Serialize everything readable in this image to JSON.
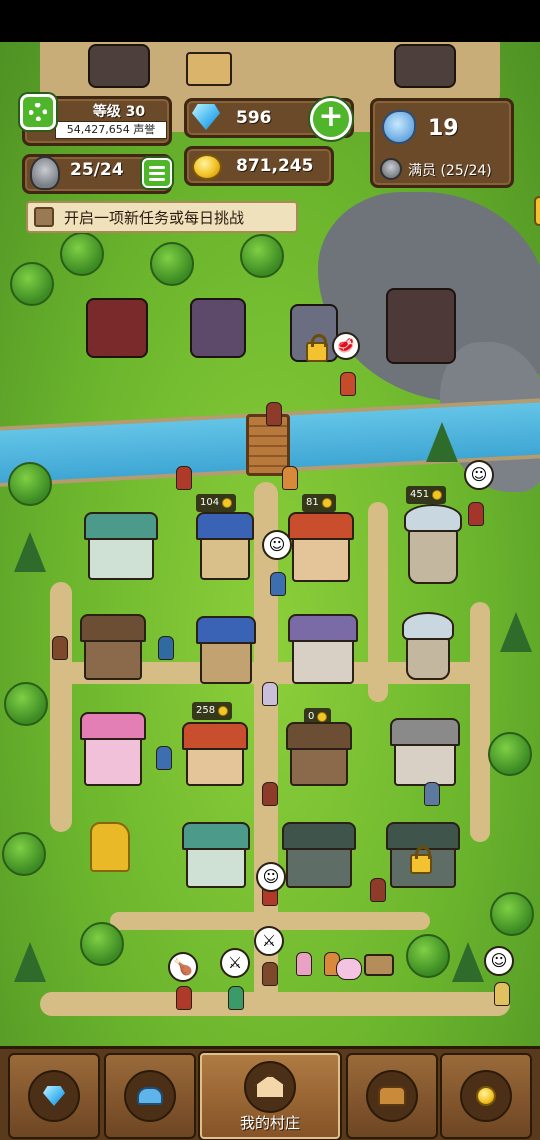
{
  "hud": {
    "level_label": "等级 30",
    "reputation": "54,427,654 声誉",
    "knights": "25/24",
    "gems": "596",
    "gold": "871,245",
    "population": "19",
    "full_label": "满员 (25/24)"
  },
  "quest": {
    "text": "开启一项新任务或每日挑战"
  },
  "buildings": {
    "badge_1": "104",
    "badge_2": "81",
    "badge_3": "451",
    "badge_4": "258",
    "badge_5": "0"
  },
  "nav": {
    "items": [
      {
        "icon": "diamond-icon",
        "label": ""
      },
      {
        "icon": "people-icon",
        "label": ""
      },
      {
        "icon": "house-icon",
        "label": "我的村庄"
      },
      {
        "icon": "chest-icon",
        "label": ""
      },
      {
        "icon": "medal-icon",
        "label": ""
      }
    ],
    "active_index": 2
  },
  "colors": {
    "grass": "#6bb52d",
    "river": "#3fa6d4",
    "panel": "#6b4a2a",
    "accent_green": "#4fb52b"
  }
}
